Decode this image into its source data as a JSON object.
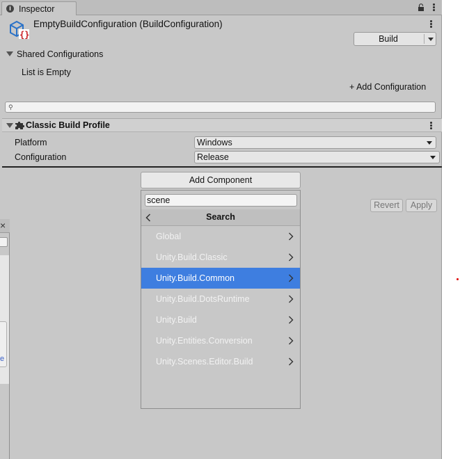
{
  "window": {
    "tab_label": "Inspector"
  },
  "asset": {
    "title": "EmptyBuildConfiguration (BuildConfiguration)",
    "build_label": "Build"
  },
  "shared": {
    "label": "Shared Configurations",
    "empty_text": "List is Empty",
    "add_label": "+ Add Configuration"
  },
  "component": {
    "title": "Classic Build Profile",
    "platform_label": "Platform",
    "platform_value": "Windows",
    "configuration_label": "Configuration",
    "configuration_value": "Release"
  },
  "actions": {
    "add_component": "Add Component",
    "revert": "Revert",
    "apply": "Apply"
  },
  "popup": {
    "search_value": "scene",
    "header": "Search",
    "items": [
      {
        "label": "Global"
      },
      {
        "label": "Unity.Build.Classic"
      },
      {
        "label": "Unity.Build.Common"
      },
      {
        "label": "Unity.Build.DotsRuntime"
      },
      {
        "label": "Unity.Build"
      },
      {
        "label": "Unity.Entities.Conversion"
      },
      {
        "label": "Unity.Scenes.Editor.Build"
      }
    ],
    "selected_index": 2
  },
  "left_panel": {
    "close_glyph": "×",
    "link_fragment": "e"
  },
  "colors": {
    "selection": "#3e7ee0",
    "panel": "#c8c8c8",
    "asset_icon": "#2a72c8",
    "asset_badge": "#c8191e"
  }
}
